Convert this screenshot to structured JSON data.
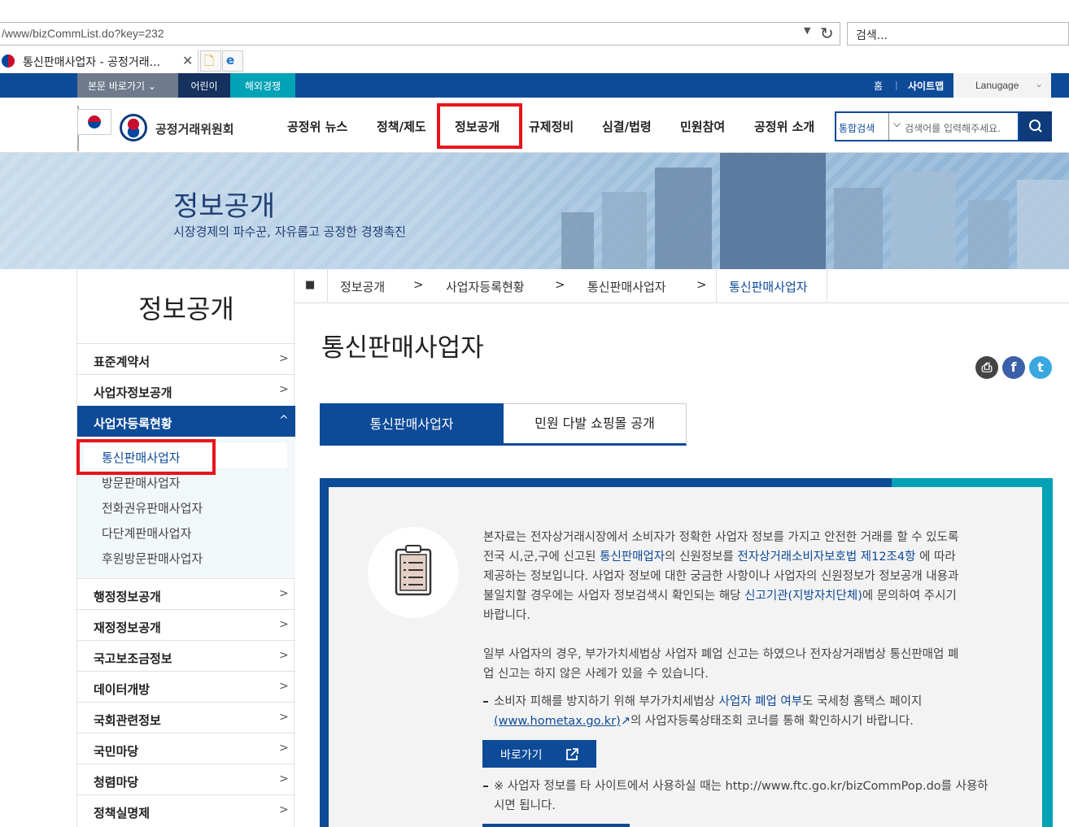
{
  "browser": {
    "url": "/www/bizCommList.do?key=232",
    "search_placeholder": "검색...",
    "tab_title": "통신판매사업자 - 공정거래..."
  },
  "util": {
    "skip": "본문 바로가기",
    "kids": "어린이",
    "intl": "해외경쟁",
    "home": "홈",
    "sitemap": "사이트맵",
    "language": "Lanugage"
  },
  "header": {
    "logo_text": "공정거래위원회",
    "gnb": [
      "공정위 뉴스",
      "정책/제도",
      "정보공개",
      "규제정비",
      "심결/법령",
      "민원참여",
      "공정위 소개"
    ],
    "search_scope": "통합검색",
    "search_placeholder": "검색어를 입력해주세요."
  },
  "banner": {
    "title": "정보공개",
    "subtitle": "시장경제의 파수꾼, 자유롭고 공정한 경쟁촉진"
  },
  "sidebar": {
    "title": "정보공개",
    "items_top": [
      "표준계약서",
      "사업자정보공개"
    ],
    "active": "사업자등록현황",
    "sub": [
      "통신판매사업자",
      "방문판매사업자",
      "전화권유판매사업자",
      "다단계판매사업자",
      "후원방문판매사업자"
    ],
    "items_bottom": [
      "행정정보공개",
      "재정정보공개",
      "국고보조금정보",
      "데이터개방",
      "국회관련정보",
      "국민마당",
      "청렴마당",
      "정책실명제"
    ]
  },
  "breadcrumb": [
    "정보공개",
    "사업자등록현황",
    "통신판매사업자",
    "통신판매사업자"
  ],
  "page": {
    "title": "통신판매사업자",
    "tab_active": "통신판매사업자",
    "tab_other": "민원 다발 쇼핑몰 공개"
  },
  "info": {
    "p1_l1": "본자료는 전자상거래시장에서 소비자가 정확한 사업자 정보를 가지고 안전한 거래를 할 수 있도록",
    "p1_l2_a": "전국 시,군,구에 신고된 ",
    "p1_l2_link1": "통신판매업자",
    "p1_l2_b": "의 신원정보를 ",
    "p1_l2_link2": "전자상거래소비자보호법 제12조4항",
    "p1_l2_c": " 에 따라",
    "p1_l3": "제공하는 정보입니다. 사업자 정보에 대한 궁금한 사항이나 사업자의 신원정보가 정보공개 내용과",
    "p1_l4_a": "불일치할 경우에는 사업자 정보검색시 확인되는 해당 ",
    "p1_l4_link": "신고기관(지방자치단체)",
    "p1_l4_b": "에 문의하여 주시기",
    "p1_l5": "바랍니다.",
    "p2_l1": "일부 사업자의 경우, 부가가치세법상 사업자 폐업 신고는 하였으나 전자상거래법상 통신판매업 폐",
    "p2_l2": "업 신고는 하지 않은 사례가 있을 수 있습니다.",
    "b1_l1_a": "소비자 피해를 방지하기 위해 부가가치세법상 ",
    "b1_l1_link": "사업자 폐업 여부",
    "b1_l1_b": "도 국세청 홈택스 페이지",
    "b1_l2_link": "(www.hometax.go.kr)",
    "b1_l2_b": "의 사업자등록상태조회 코너를 통해 확인하시기 바랍니다.",
    "go_button": "바로가기",
    "b2_l1": "※ 사업자 정보를 타 사이트에서 사용하실 때는 http://www.ftc.go.kr/bizCommPop.do를 사용하",
    "b2_l2": "시면 됩니다."
  },
  "colors": {
    "primary": "#0d4a98",
    "teal": "#00a2b5",
    "highlight": "#e8141c"
  }
}
